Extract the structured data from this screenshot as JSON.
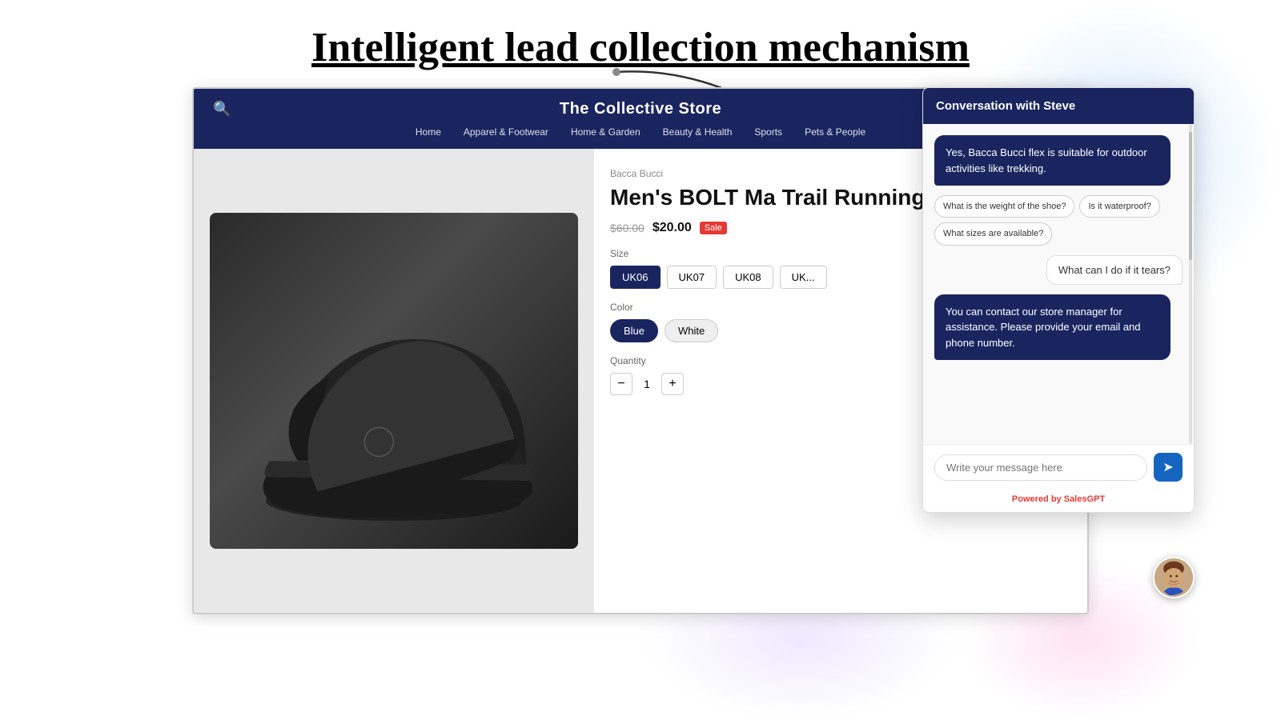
{
  "page": {
    "title": "Intelligent lead collection mechanism",
    "background": "#ffffff"
  },
  "store": {
    "name": "The Collective Store",
    "nav_links": [
      "Home",
      "Apparel & Footwear",
      "Home & Garden",
      "Beauty & Health",
      "Sports",
      "Pets & People"
    ]
  },
  "product": {
    "brand": "Bacca Bucci",
    "name": "Men's BOLT Ma Trail Running S",
    "price_old": "$60.00",
    "price_new": "$20.00",
    "sale_badge": "Sale",
    "size_label": "Size",
    "sizes": [
      "UK06",
      "UK07",
      "UK08",
      "UK..."
    ],
    "active_size": "UK06",
    "color_label": "Color",
    "colors": [
      "Blue",
      "White"
    ],
    "active_color": "Blue",
    "qty_label": "Quantity",
    "qty_value": "1"
  },
  "chat": {
    "header": "Conversation with Steve",
    "messages": [
      {
        "type": "bot",
        "text": "Yes, Bacca Bucci flex is suitable for outdoor activities like trekking."
      },
      {
        "type": "suggestions",
        "items": [
          "What is the weight of the shoe?",
          "Is it waterproof?",
          "What sizes are available?"
        ]
      },
      {
        "type": "user",
        "text": "What can I do if it tears?"
      },
      {
        "type": "bot",
        "text": "You can contact our store manager for assistance. Please provide your email and phone number."
      }
    ],
    "input_placeholder": "Write your message here",
    "send_icon": "➤",
    "footer_text": "Powered by ",
    "footer_brand": "SalesGPT"
  }
}
